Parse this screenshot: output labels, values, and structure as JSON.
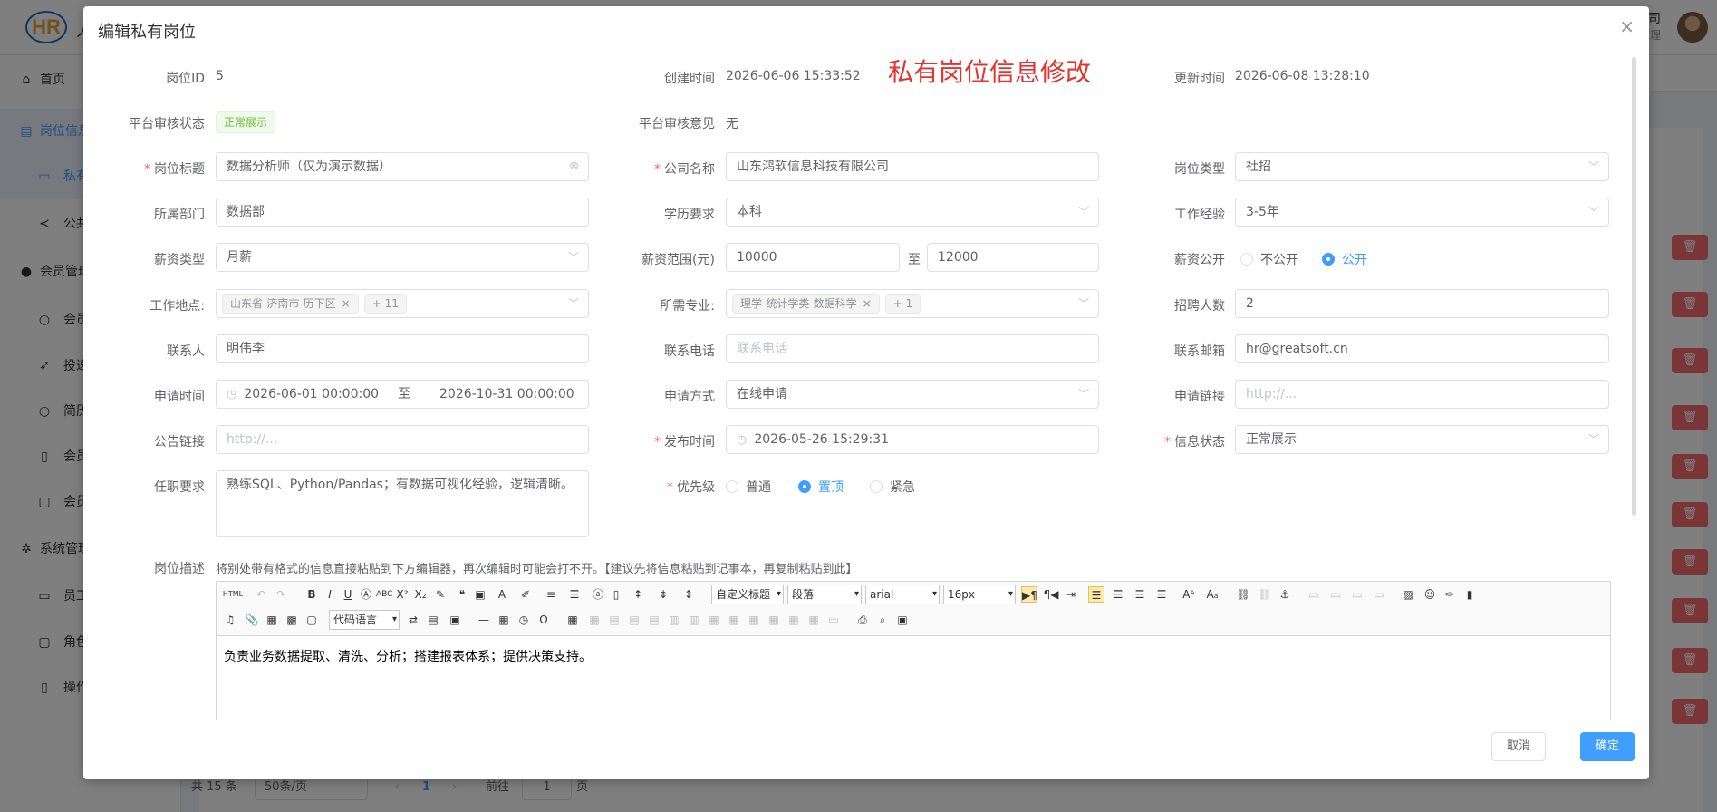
{
  "app": {
    "logo_text": "HR",
    "logo_tail": "人",
    "company_name": "公司",
    "company_role": "管理"
  },
  "sidebar": {
    "items": [
      {
        "label": "首页",
        "icon": "home-icon"
      },
      {
        "label": "岗位信息",
        "icon": "briefcase-icon"
      },
      {
        "label": "私有",
        "icon": "folder-icon"
      },
      {
        "label": "公共",
        "icon": "share-icon"
      },
      {
        "label": "会员管理",
        "icon": "user-icon"
      },
      {
        "label": "会员",
        "icon": "person-icon"
      },
      {
        "label": "投递",
        "icon": "send-icon"
      },
      {
        "label": "简历",
        "icon": "search-icon"
      },
      {
        "label": "会员",
        "icon": "book-icon"
      },
      {
        "label": "会员",
        "icon": "lock-icon"
      },
      {
        "label": "系统管理",
        "icon": "gear-icon"
      },
      {
        "label": "员工",
        "icon": "id-card-icon"
      },
      {
        "label": "角色",
        "icon": "lock-icon"
      },
      {
        "label": "操作",
        "icon": "document-icon"
      }
    ]
  },
  "pager": {
    "total": "共 15 条",
    "page_size": "50条/页",
    "current": "1",
    "goto_label": "前往",
    "goto_value": "1",
    "goto_unit": "页"
  },
  "dialog": {
    "title": "编辑私有岗位",
    "highlight": "私有岗位信息修改",
    "fields": {
      "job_id": {
        "label": "岗位ID",
        "value": "5"
      },
      "created": {
        "label": "创建时间",
        "value": "2026-06-06 15:33:52"
      },
      "updated": {
        "label": "更新时间",
        "value": "2026-06-08 13:28:10"
      },
      "audit_status": {
        "label": "平台审核状态",
        "value": "正常展示"
      },
      "audit_opinion": {
        "label": "平台审核意见",
        "value": "无"
      },
      "job_title": {
        "label": "岗位标题",
        "value": "数据分析师（仅为演示数据）"
      },
      "company": {
        "label": "公司名称",
        "value": "山东鸿软信息科技有限公司"
      },
      "job_type": {
        "label": "岗位类型",
        "value": "社招"
      },
      "department": {
        "label": "所属部门",
        "value": "数据部"
      },
      "education": {
        "label": "学历要求",
        "value": "本科"
      },
      "experience": {
        "label": "工作经验",
        "value": "3-5年"
      },
      "salary_type": {
        "label": "薪资类型",
        "value": "月薪"
      },
      "salary_range": {
        "label": "薪资范围(元)",
        "min": "10000",
        "sep": "至",
        "max": "12000"
      },
      "salary_public": {
        "label": "薪资公开",
        "options": [
          "不公开",
          "公开"
        ],
        "selected": "公开"
      },
      "location": {
        "label": "工作地点:",
        "tag": "山东省-济南市-历下区",
        "more": "+ 11"
      },
      "major": {
        "label": "所需专业:",
        "tag": "理学-统计学类-数据科学",
        "more": "+ 1"
      },
      "headcount": {
        "label": "招聘人数",
        "value": "2"
      },
      "contact": {
        "label": "联系人",
        "value": "明伟李"
      },
      "phone": {
        "label": "联系电话",
        "placeholder": "联系电话"
      },
      "email": {
        "label": "联系邮箱",
        "value": "hr@greatsoft.cn"
      },
      "apply_time": {
        "label": "申请时间",
        "start": "2026-06-01 00:00:00",
        "sep": "至",
        "end": "2026-10-31 00:00:00"
      },
      "apply_method": {
        "label": "申请方式",
        "value": "在线申请"
      },
      "apply_link": {
        "label": "申请链接",
        "placeholder": "http://..."
      },
      "notice_link": {
        "label": "公告链接",
        "placeholder": "http://..."
      },
      "publish_time": {
        "label": "发布时间",
        "value": "2026-05-26 15:29:31"
      },
      "info_status": {
        "label": "信息状态",
        "value": "正常展示"
      },
      "requirements": {
        "label": "任职要求",
        "value": "熟练SQL、Python/Pandas；有数据可视化经验，逻辑清晰。"
      },
      "priority": {
        "label": "优先级",
        "options": [
          "普通",
          "置顶",
          "紧急"
        ],
        "selected": "置顶"
      },
      "description": {
        "label": "岗位描述",
        "hint": "将别处带有格式的信息直接粘贴到下方编辑器，再次编辑时可能会打不开。【建议先将信息粘贴到记事本，再复制粘贴到此】",
        "content": "负责业务数据提取、清洗、分析；搭建报表体系；提供决策支持。"
      }
    },
    "editor_toolbar": {
      "html_label": "HTML",
      "heading_select": "自定义标题",
      "paragraph_select": "段落",
      "font_select": "arial",
      "size_select": "16px",
      "code_select": "代码语言"
    },
    "buttons": {
      "cancel": "取消",
      "ok": "确定"
    }
  }
}
